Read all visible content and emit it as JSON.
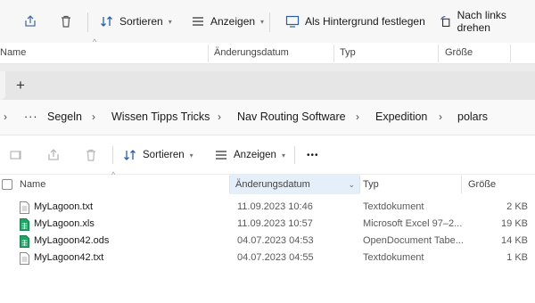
{
  "back_window": {
    "toolbar": {
      "sort_label": "Sortieren",
      "view_label": "Anzeigen",
      "wallpaper_label": "Als Hintergrund festlegen",
      "rotate_label": "Nach links drehen"
    },
    "columns": {
      "name": "Name",
      "date": "Änderungsdatum",
      "type": "Typ",
      "size": "Größe"
    }
  },
  "breadcrumb": {
    "more": "···",
    "items": [
      "Segeln",
      "Wissen Tipps Tricks",
      "Nav Routing Software",
      "Expedition",
      "polars"
    ]
  },
  "tabbar": {
    "add_tab": "+"
  },
  "toolbar": {
    "sort_label": "Sortieren",
    "view_label": "Anzeigen",
    "more_label": "•••"
  },
  "columns": {
    "name": "Name",
    "date": "Änderungsdatum",
    "type": "Typ",
    "size": "Größe"
  },
  "files": [
    {
      "name": "MyLagoon.txt",
      "date": "11.09.2023 10:46",
      "type": "Textdokument",
      "size": "2 KB",
      "icon": "text-file-icon"
    },
    {
      "name": "MyLagoon.xls",
      "date": "11.09.2023 10:57",
      "type": "Microsoft Excel 97–2...",
      "size": "19 KB",
      "icon": "spreadsheet-file-icon"
    },
    {
      "name": "MyLagoon42.ods",
      "date": "04.07.2023 04:53",
      "type": "OpenDocument Tabe...",
      "size": "14 KB",
      "icon": "spreadsheet-file-icon"
    },
    {
      "name": "MyLagoon42.txt",
      "date": "04.07.2023 04:55",
      "type": "Textdokument",
      "size": "1 KB",
      "icon": "text-file-icon"
    }
  ],
  "colors": {
    "sorted_column_bg": "#e4effa",
    "spreadsheet_green": "#21a366",
    "disabled_icon": "#b8b8b8"
  }
}
